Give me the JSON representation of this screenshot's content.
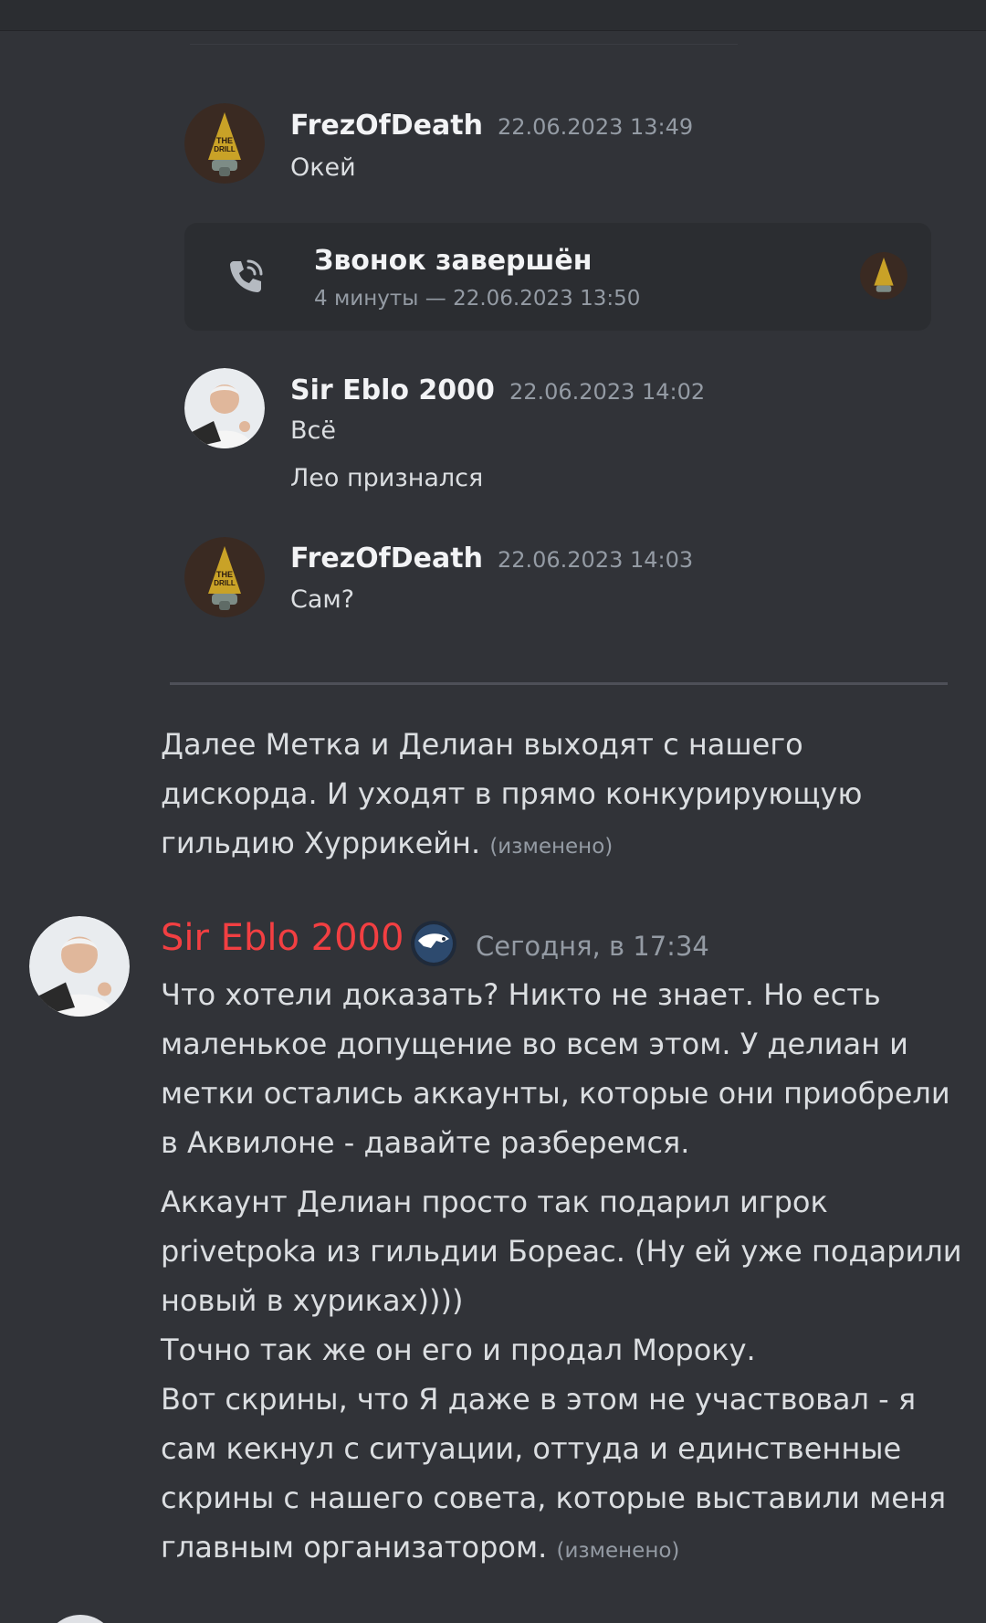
{
  "quoted": {
    "messages": [
      {
        "author": "FrezOfDeath",
        "timestamp": "22.06.2023 13:49",
        "lines": [
          "Окей"
        ]
      },
      {
        "author": "Sir Eblo 2000",
        "timestamp": "22.06.2023 14:02",
        "lines": [
          "Всё",
          "Лео признался"
        ]
      },
      {
        "author": "FrezOfDeath",
        "timestamp": "22.06.2023 14:03",
        "lines": [
          "Сам?"
        ]
      }
    ],
    "call": {
      "title": "Звонок завершён",
      "subtitle": "4 минуты — 22.06.2023 13:50"
    }
  },
  "continuation": {
    "text": "Далее Метка и Делиан выходят с нашего дискорда. И уходят в прямо конкурирующую гильдию Хуррикейн.",
    "edited": "(изменено)"
  },
  "message": {
    "author": "Sir Eblo 2000",
    "timestamp": "Сегодня, в 17:34",
    "author_color": "#f23f42",
    "paragraphs": [
      "Что хотели доказать? Никто не знает. Но есть маленькое допущение во всем этом. У делиан и метки остались аккаунты, которые они приобрели в Аквилоне - давайте разберемся.",
      "Аккаунт Делиан просто так подарил игрок privetpoka из гильдии Бореас. (Ну ей уже подарили новый в хуриках))))\nТочно так же он его и продал Мороку.\nВот скрины, что Я даже в этом не участвовал - я сам кекнул с ситуации, оттуда и единственные скрины с нашего совета, которые выставили меня главным организатором."
    ],
    "edited": "(изменено)"
  },
  "icons": [
    "phone-call-icon",
    "avatar-frezofdeath",
    "avatar-sir-eblo",
    "server-badge-icon"
  ],
  "colors": {
    "background": "#313338",
    "card": "#2b2d31",
    "text": "#dbdee1",
    "muted": "#949ba4",
    "author": "#f23f42"
  }
}
